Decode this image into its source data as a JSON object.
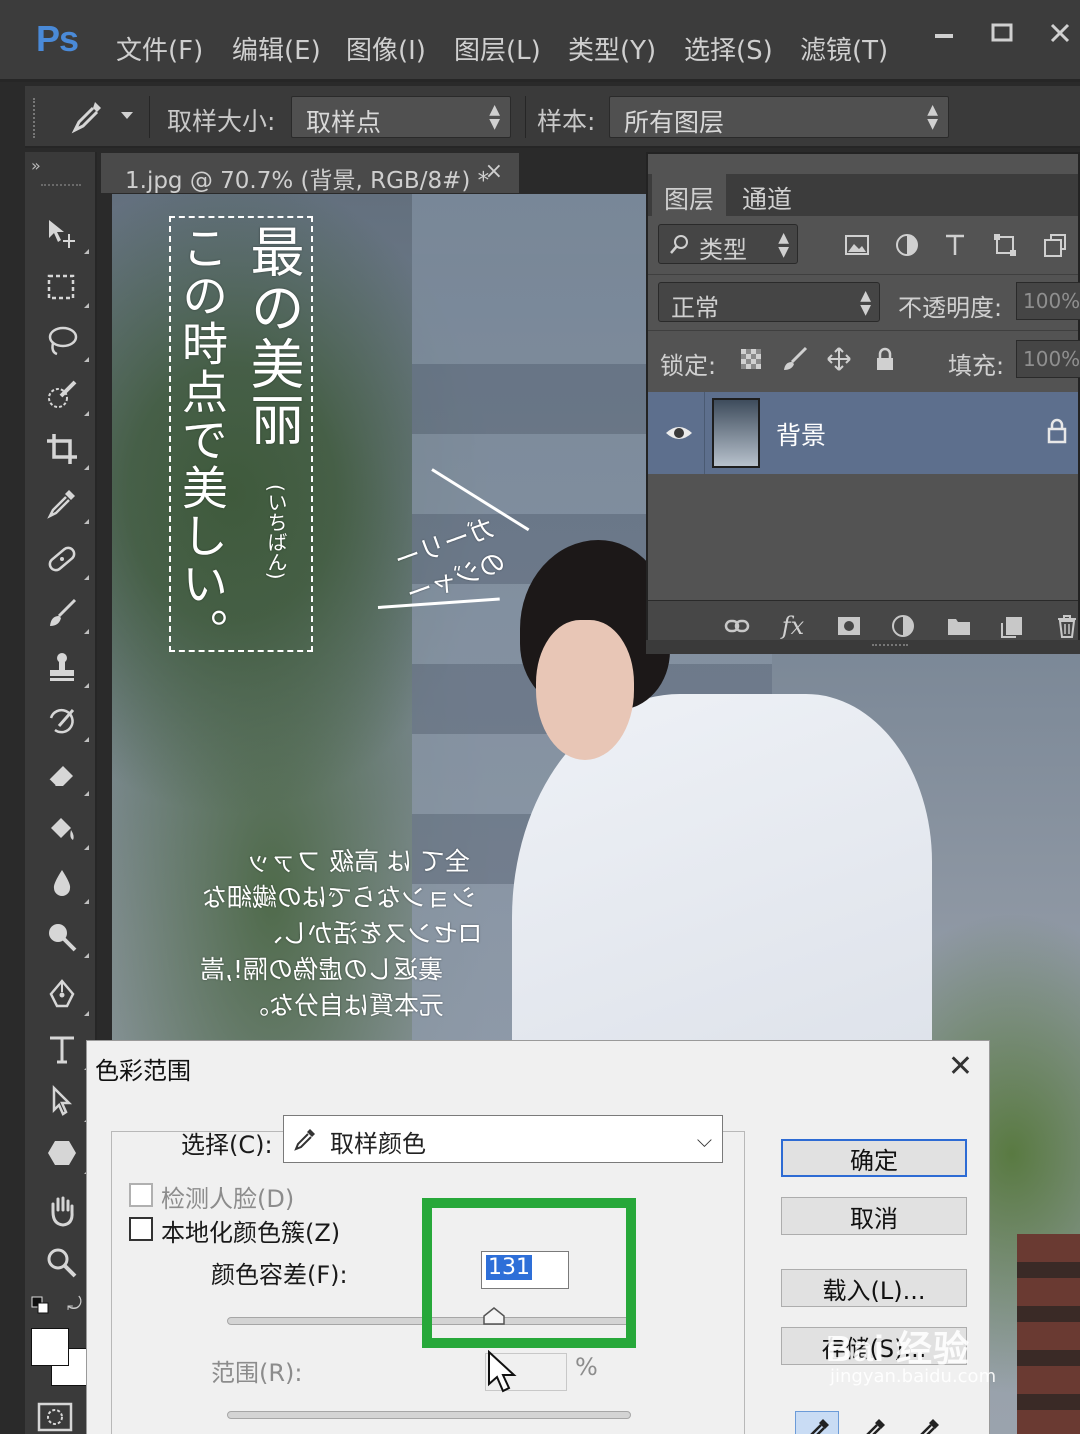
{
  "app": {
    "logo": "Ps",
    "menu": [
      "文件(F)",
      "编辑(E)",
      "图像(I)",
      "图层(L)",
      "类型(Y)",
      "选择(S)",
      "滤镜(T)"
    ]
  },
  "options_bar": {
    "sample_size_label": "取样大小:",
    "sample_size_value": "取样点",
    "sample_label": "样本:",
    "sample_value": "所有图层"
  },
  "document_tab": {
    "title": "1.jpg @ 70.7% (背景, RGB/8#) *",
    "close": "×"
  },
  "canvas_text": {
    "vertical_main": "最の美丽",
    "vertical_small": "(いちばん)",
    "vertical_second": "この時点で美しい。",
    "diag_line1": "ガーリー",
    "diag_line2": "のジャー",
    "para": [
      "全て は 高級 ファッ",
      "ションならではの繊細な",
      "ロセンスを活かし、",
      "裏返しの虚偽の隔!,嵩",
      "元本質は自分な。"
    ]
  },
  "layers_panel": {
    "tabs": [
      "图层",
      "通道"
    ],
    "filter_label": "类型",
    "blend_mode": "正常",
    "opacity_label": "不透明度:",
    "opacity_value": "100%",
    "lock_label": "锁定:",
    "fill_label": "填充:",
    "fill_value": "100%",
    "layer_name": "背景"
  },
  "dialog": {
    "title": "色彩范围",
    "close": "✕",
    "select_label": "选择(C):",
    "select_value": "取样颜色",
    "detect_faces": "检测人脸(D)",
    "localized_clusters": "本地化颜色簇(Z)",
    "fuzziness_label": "颜色容差(F):",
    "fuzziness_value": "131",
    "fuzziness_slider": 0.66,
    "range_label": "范围(R):",
    "range_unit": "%",
    "buttons": {
      "ok": "确定",
      "cancel": "取消",
      "load": "载入(L)...",
      "save": "存储(S)..."
    }
  },
  "watermark": {
    "main": "Bai 经验",
    "sub": "jingyan.baidu.com"
  }
}
